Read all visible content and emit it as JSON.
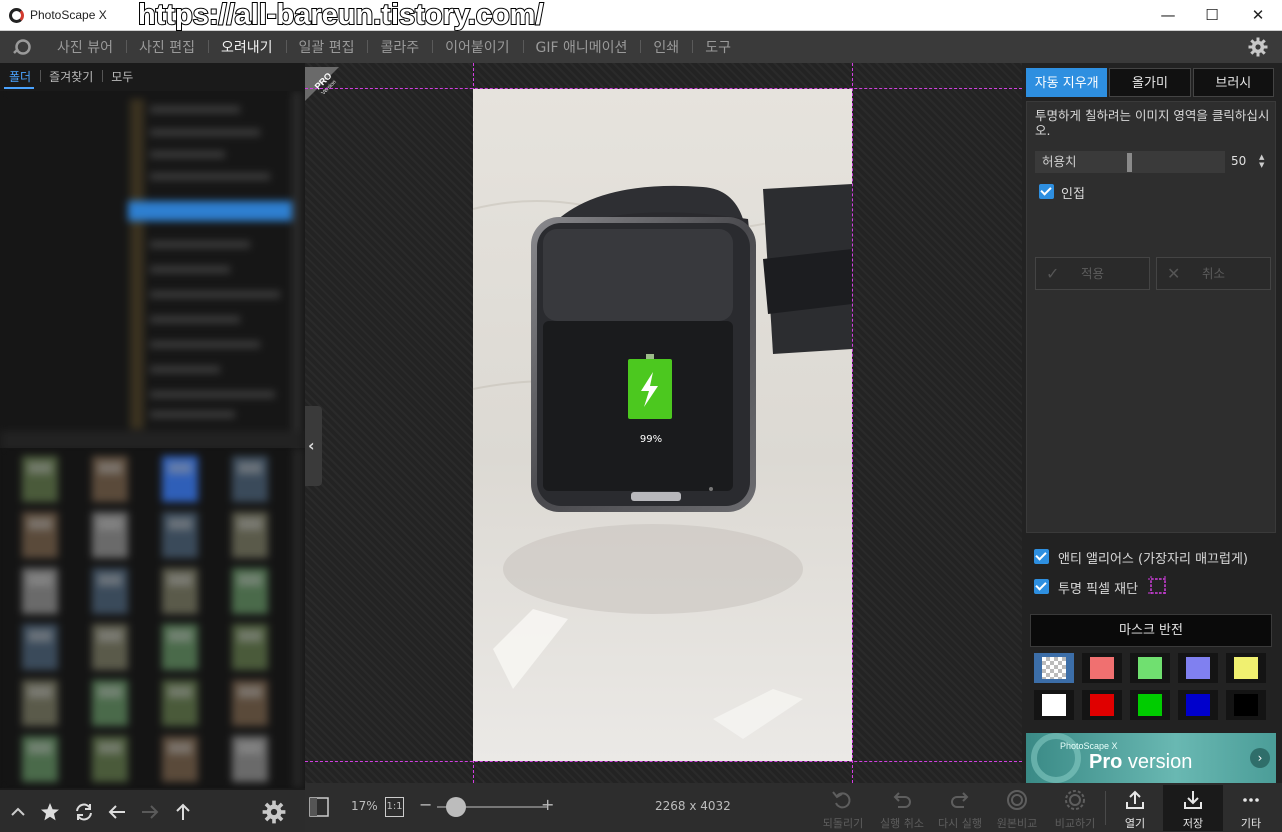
{
  "window": {
    "app_title": "PhotoScape X",
    "watermark": "https://all-bareun.tistory.com/",
    "controls": {
      "minimize": "—",
      "maximize": "☐",
      "close": "✕"
    }
  },
  "menu": {
    "items": [
      "사진 뷰어",
      "사진 편집",
      "오려내기",
      "일괄 편집",
      "콜라주",
      "이어붙이기",
      "GIF 애니메이션",
      "인쇄",
      "도구"
    ],
    "active": "오려내기"
  },
  "left_panel": {
    "tabs": [
      "폴더",
      "즐겨찾기",
      "모두"
    ],
    "active_tab": "폴더"
  },
  "canvas": {
    "pro_badge": "PRO",
    "pro_badge_sub": "Version",
    "photo_battery": "99%"
  },
  "bottom_bar": {
    "zoom": "17%",
    "actual_size": "1:1",
    "zoom_level": 0.17,
    "dimensions": "2268 x 4032",
    "tools": [
      {
        "label": "되돌리기",
        "icon": "revert-icon",
        "enabled": false
      },
      {
        "label": "실행 취소",
        "icon": "undo-icon",
        "enabled": false
      },
      {
        "label": "다시 실행",
        "icon": "redo-icon",
        "enabled": false
      },
      {
        "label": "원본비교",
        "icon": "compare-original-icon",
        "enabled": false
      },
      {
        "label": "비교하기",
        "icon": "compare-icon",
        "enabled": false
      },
      {
        "label": "열기",
        "icon": "open-icon",
        "enabled": true
      },
      {
        "label": "저장",
        "icon": "save-icon",
        "enabled": true
      },
      {
        "label": "기타",
        "icon": "more-icon",
        "enabled": true
      }
    ]
  },
  "right_panel": {
    "tabs": [
      "자동 지우개",
      "올가미",
      "브러시"
    ],
    "active_tab": "자동 지우개",
    "description": "투명하게 칠하려는 이미지 영역을 클릭하십시오.",
    "tolerance": {
      "label": "허용치",
      "value": "50"
    },
    "contiguous": {
      "label": "인접",
      "checked": true
    },
    "apply_label": "적용",
    "cancel_label": "취소",
    "antialias": {
      "label": "앤티 앨리어스 (가장자리 매끄럽게)",
      "checked": true
    },
    "trim": {
      "label": "투명 픽셀 재단",
      "checked": true
    },
    "invert_mask": "마스크 반전",
    "swatches": [
      {
        "color": "checker-white",
        "selected": true
      },
      {
        "color": "#f07070"
      },
      {
        "color": "#70e070"
      },
      {
        "color": "#8080f0"
      },
      {
        "color": "#f0f070"
      },
      {
        "color": "#ffffff"
      },
      {
        "color": "#e00000"
      },
      {
        "color": "#00cc00"
      },
      {
        "color": "#0000cc"
      },
      {
        "color": "#000000"
      }
    ],
    "banner_small": "PhotoScape X",
    "banner_pro": "Pro",
    "banner_version": " version"
  }
}
